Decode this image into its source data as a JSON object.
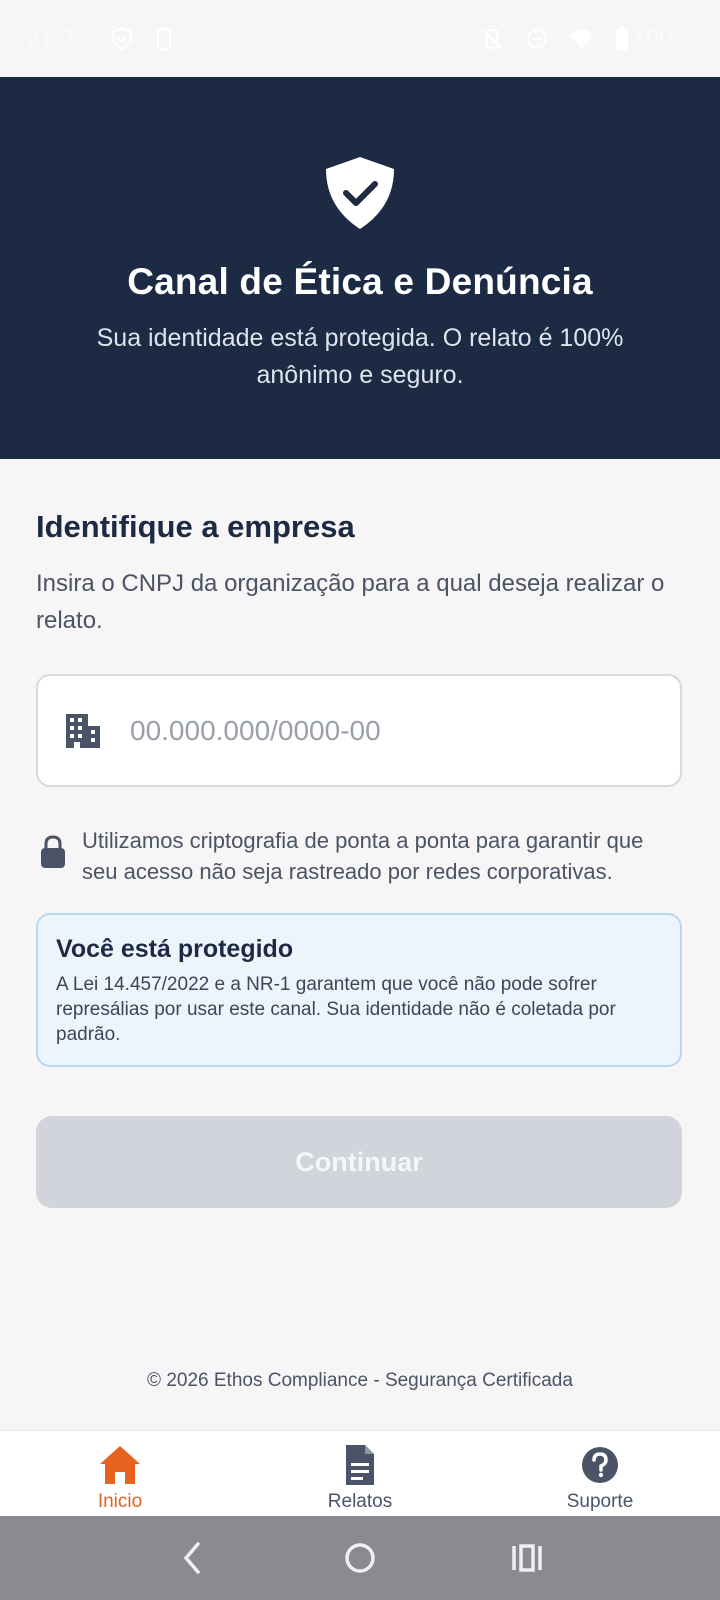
{
  "status_bar": {
    "time": "21:32",
    "battery_percent": "100%",
    "icons": [
      "shield-status-icon",
      "phone-status-icon",
      "vibrate-off-icon",
      "do-not-disturb-icon",
      "wifi-icon",
      "battery-icon"
    ]
  },
  "header": {
    "icon": "shield-check-icon",
    "title": "Canal de Ética e Denúncia",
    "subtitle": "Sua identidade está protegida. O relato é 100% anônimo e seguro."
  },
  "company_section": {
    "title": "Identifique a empresa",
    "description": "Insira o CNPJ da organização para a qual deseja realizar o relato.",
    "cnpj_input": {
      "icon": "building-icon",
      "value": "",
      "placeholder": "00.000.000/0000-00"
    },
    "crypto_note": {
      "icon": "lock-icon",
      "text": "Utilizamos criptografia de ponta a ponta para garantir que seu acesso não seja rastreado por redes corporativas."
    }
  },
  "protection_box": {
    "title": "Você está protegido",
    "text": "A Lei 14.457/2022 e a NR-1 garantem que você não pode sofrer represálias por usar este canal. Sua identidade não é coletada por padrão."
  },
  "continue_button": {
    "label": "Continuar",
    "enabled": false
  },
  "footer": {
    "text": "© 2026 Ethos Compliance - Segurança Certificada"
  },
  "bottom_nav": {
    "items": [
      {
        "label": "Inicio",
        "icon": "home-icon",
        "active": true
      },
      {
        "label": "Relatos",
        "icon": "document-icon",
        "active": false
      },
      {
        "label": "Suporte",
        "icon": "help-icon",
        "active": false
      }
    ]
  },
  "colors": {
    "header_bg": "#1c2a44",
    "accent": "#e8621f",
    "button_disabled": "#d1d4da",
    "info_box_bg": "#eef4fc",
    "info_box_border": "#b9d7f1"
  }
}
